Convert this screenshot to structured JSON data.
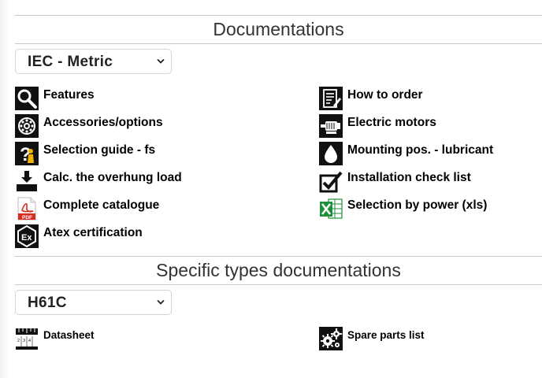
{
  "documentations": {
    "title": "Documentations",
    "select_value": "IEC - Metric",
    "left_items": [
      {
        "label": "Features",
        "icon": "magnifier-icon"
      },
      {
        "label": "Accessories/options",
        "icon": "bearing-icon"
      },
      {
        "label": "Selection guide - fs",
        "icon": "question-person-icon"
      },
      {
        "label": "Calc. the overhung load",
        "icon": "load-arrow-icon"
      },
      {
        "label": "Complete catalogue",
        "icon": "pdf-icon"
      },
      {
        "label": "Atex certification",
        "icon": "atex-icon"
      }
    ],
    "right_items": [
      {
        "label": "How to order",
        "icon": "order-form-icon"
      },
      {
        "label": "Electric motors",
        "icon": "electric-motor-icon"
      },
      {
        "label": "Mounting pos. - lubricant",
        "icon": "oil-drop-icon"
      },
      {
        "label": "Installation check list",
        "icon": "checkbox-icon"
      },
      {
        "label": "Selection by power (xls)",
        "icon": "excel-icon"
      }
    ]
  },
  "specific": {
    "title": "Specific types documentations",
    "select_value": "H61C",
    "items": [
      {
        "label": "Datasheet",
        "icon": "datasheet-icon"
      },
      {
        "label": "Spare parts list",
        "icon": "gears-icon"
      }
    ]
  },
  "colors": {
    "icon_bg": "#111111",
    "pdf_red": "#d92b20",
    "excel_green": "#1f8f3a",
    "rule": "#c8c8c8"
  }
}
